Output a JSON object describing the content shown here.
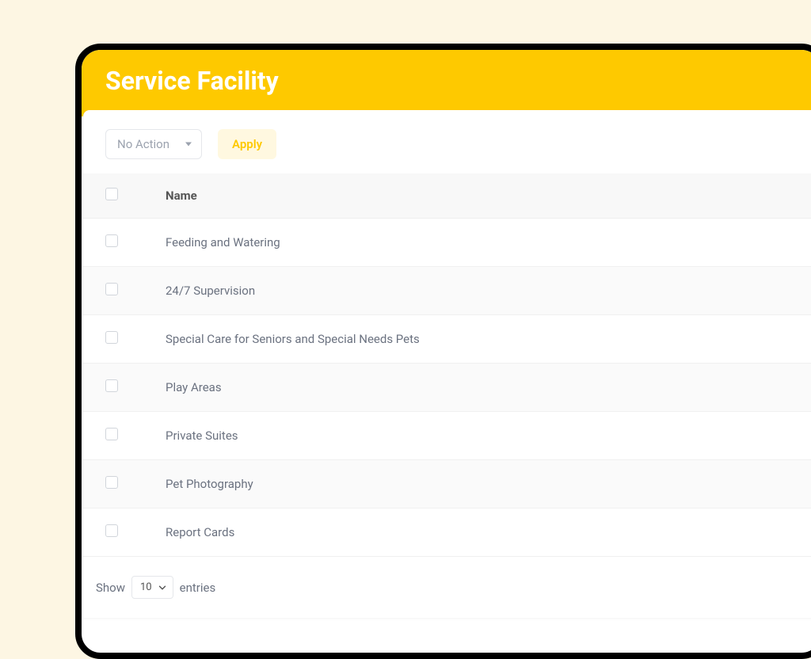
{
  "header": {
    "title": "Service Facility"
  },
  "toolbar": {
    "action_dropdown": "No Action",
    "apply_label": "Apply"
  },
  "table": {
    "columns": {
      "name": "Name"
    },
    "rows": [
      {
        "name": "Feeding and Watering"
      },
      {
        "name": "24/7 Supervision"
      },
      {
        "name": "Special Care for Seniors and Special Needs Pets"
      },
      {
        "name": "Play Areas"
      },
      {
        "name": "Private Suites"
      },
      {
        "name": "Pet Photography"
      },
      {
        "name": "Report Cards"
      }
    ]
  },
  "footer": {
    "show_label": "Show",
    "entries_value": "10",
    "entries_label": "entries"
  }
}
